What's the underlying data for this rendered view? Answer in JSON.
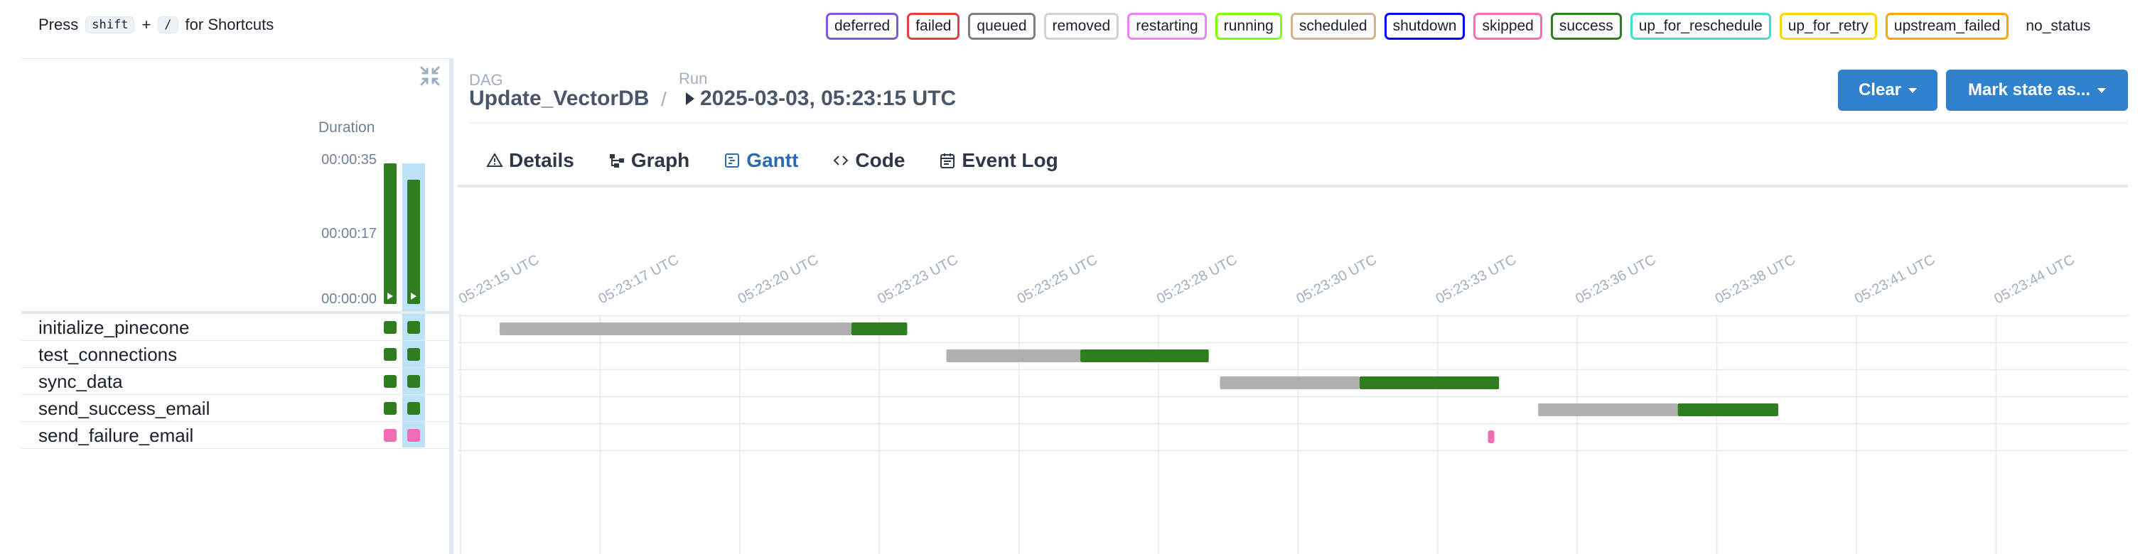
{
  "shortcuts": {
    "press": "Press",
    "key1": "shift",
    "plus": "+",
    "key2": "/",
    "suffix": "for Shortcuts"
  },
  "legend": [
    {
      "label": "deferred",
      "color": "#805ad5"
    },
    {
      "label": "failed",
      "color": "#e53e3e"
    },
    {
      "label": "queued",
      "color": "#808080"
    },
    {
      "label": "removed",
      "color": "#d3d3d3"
    },
    {
      "label": "restarting",
      "color": "#ee82ee"
    },
    {
      "label": "running",
      "color": "#7fff00"
    },
    {
      "label": "scheduled",
      "color": "#d2b48c"
    },
    {
      "label": "shutdown",
      "color": "#0000ff"
    },
    {
      "label": "skipped",
      "color": "#ff69b4"
    },
    {
      "label": "success",
      "color": "#2f7d1e"
    },
    {
      "label": "up_for_reschedule",
      "color": "#40e0d0"
    },
    {
      "label": "up_for_retry",
      "color": "#ffd700"
    },
    {
      "label": "upstream_failed",
      "color": "#ffa500"
    },
    {
      "label": "no_status",
      "color": ""
    }
  ],
  "breadcrumb": {
    "dag_label": "DAG",
    "dag_name": "Update_VectorDB",
    "separator": "/",
    "run_label": "Run",
    "run_name": "2025-03-03, 05:23:15 UTC"
  },
  "buttons": {
    "clear": "Clear",
    "mark_state": "Mark state as..."
  },
  "tabs": [
    {
      "label": "Details",
      "icon": "warning-icon",
      "active": false
    },
    {
      "label": "Graph",
      "icon": "graph-icon",
      "active": false
    },
    {
      "label": "Gantt",
      "icon": "gantt-icon",
      "active": true
    },
    {
      "label": "Code",
      "icon": "code-icon",
      "active": false
    },
    {
      "label": "Event Log",
      "icon": "calendar-icon",
      "active": false
    }
  ],
  "duration_chart": {
    "label": "Duration",
    "ticks": [
      "00:00:35",
      "00:00:17",
      "00:00:00"
    ],
    "runs": [
      {
        "duration_s": 35
      },
      {
        "duration_s": 31
      }
    ]
  },
  "tasks": [
    {
      "name": "initialize_pinecone",
      "state_color": "#2f7d1e"
    },
    {
      "name": "test_connections",
      "state_color": "#2f7d1e"
    },
    {
      "name": "sync_data",
      "state_color": "#2f7d1e"
    },
    {
      "name": "send_success_email",
      "state_color": "#2f7d1e"
    },
    {
      "name": "send_failure_email",
      "state_color": "#f36bb5"
    }
  ],
  "chart_data": {
    "type": "gantt",
    "x_ticks": [
      "05:23:15 UTC",
      "05:23:17 UTC",
      "05:23:20 UTC",
      "05:23:23 UTC",
      "05:23:25 UTC",
      "05:23:28 UTC",
      "05:23:30 UTC",
      "05:23:33 UTC",
      "05:23:36 UTC",
      "05:23:38 UTC",
      "05:23:41 UTC",
      "05:23:44 UTC"
    ],
    "tasks": [
      {
        "name": "initialize_pinecone",
        "queued_start": 15.7,
        "start": 22.0,
        "end": 23.0,
        "state": "success"
      },
      {
        "name": "test_connections",
        "queued_start": 23.7,
        "start": 26.1,
        "end": 28.4,
        "state": "success"
      },
      {
        "name": "sync_data",
        "queued_start": 28.6,
        "start": 31.1,
        "end": 33.6,
        "state": "success"
      },
      {
        "name": "send_success_email",
        "queued_start": 34.3,
        "start": 36.8,
        "end": 38.6,
        "state": "success"
      },
      {
        "name": "send_failure_email",
        "queued_start": 33.4,
        "start": 33.4,
        "end": 33.5,
        "state": "skipped"
      }
    ],
    "colors": {
      "queued": "#b0b0b0",
      "success": "#2f7d1e",
      "skipped": "#f36bb5"
    }
  }
}
